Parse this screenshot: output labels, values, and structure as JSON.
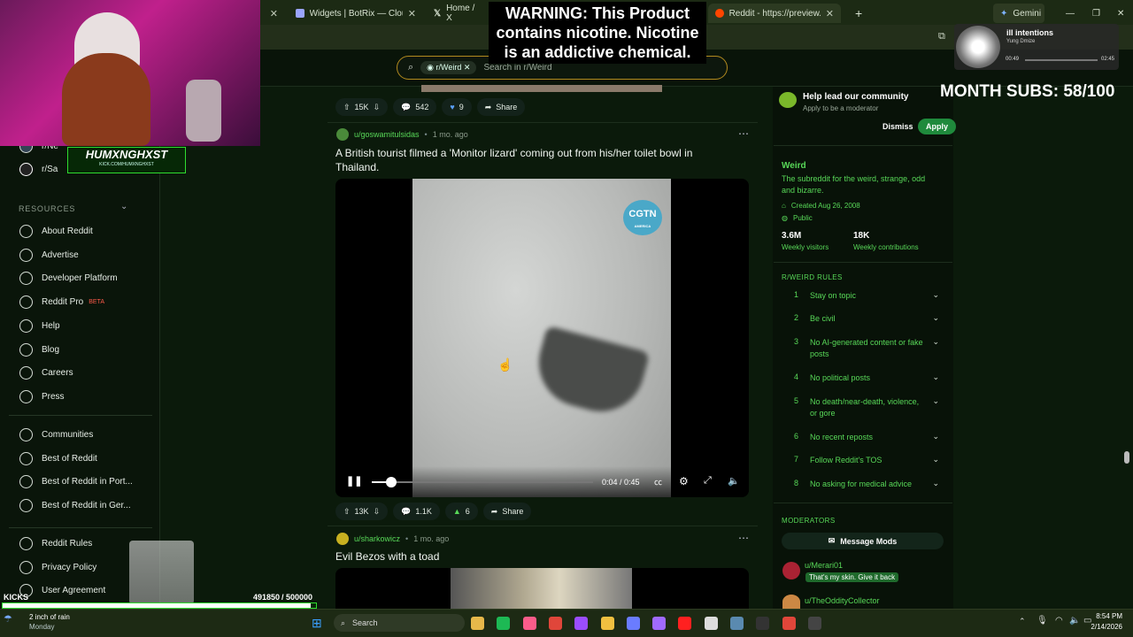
{
  "browser": {
    "tabs": [
      {
        "label": "Widgets | BotRix — Cloud Strea",
        "icon": "botrix-icon"
      },
      {
        "label": "Home / X",
        "icon": "x-logo-icon"
      },
      {
        "label": "Reddit - https://preview.redd.it",
        "icon": "reddit-icon"
      }
    ],
    "gemini_label": "Gemini"
  },
  "overlay": {
    "warning": "WARNING: This Product contains nicotine. Nicotine is an addictive chemical.",
    "subs": "MONTH SUBS: 58/100",
    "streamer_name": "HUMXNGHXST",
    "streamer_url": "KICK.COM/HUMXNGHXST",
    "kicks_label": "KICKS",
    "kicks_value": "491850",
    "kicks_goal": "/ 500000",
    "music_title": "ill intentions",
    "music_artist": "Yung Dmize",
    "music_elapsed": "00:49",
    "music_total": "02:45"
  },
  "search": {
    "chip": "r/Weird",
    "placeholder": "Search in r/Weird"
  },
  "sidebar": {
    "partial_items": [
      "r/Ne",
      "r/Sa"
    ],
    "resources_label": "RESOURCES",
    "items": [
      {
        "label": "About Reddit",
        "icon": "reddit-alien-icon"
      },
      {
        "label": "Advertise",
        "icon": "megaphone-icon"
      },
      {
        "label": "Developer Platform",
        "icon": "developer-icon"
      },
      {
        "label": "Reddit Pro",
        "icon": "pro-icon",
        "badge": "BETA"
      },
      {
        "label": "Help",
        "icon": "help-icon"
      },
      {
        "label": "Blog",
        "icon": "blog-icon"
      },
      {
        "label": "Careers",
        "icon": "careers-icon"
      },
      {
        "label": "Press",
        "icon": "press-icon"
      }
    ],
    "items2": [
      {
        "label": "Communities",
        "icon": "communities-icon"
      },
      {
        "label": "Best of Reddit",
        "icon": "book-icon"
      },
      {
        "label": "Best of Reddit in Port...",
        "icon": "translate-icon"
      },
      {
        "label": "Best of Reddit in Ger...",
        "icon": "translate-icon"
      }
    ],
    "items3": [
      {
        "label": "Reddit Rules",
        "icon": "rules-icon"
      },
      {
        "label": "Privacy Policy",
        "icon": "privacy-icon"
      },
      {
        "label": "User Agreement",
        "icon": "agreement-icon"
      }
    ]
  },
  "post0": {
    "votes": "15K",
    "comments": "542",
    "awards": "9",
    "share": "Share"
  },
  "post1": {
    "author": "u/goswamitulsidas",
    "age": "1 mo. ago",
    "title": "A British tourist filmed a 'Monitor lizard' coming out from his/her toilet bowl in Thailand.",
    "watermark": "CGTN",
    "watermark_sub": "AMERICA",
    "time": "0:04 / 0:45",
    "progress": 0.089,
    "votes": "13K",
    "comments": "1.1K",
    "awards": "6",
    "share": "Share"
  },
  "post2": {
    "author": "u/sharkowicz",
    "age": "1 mo. ago",
    "title": "Evil Bezos with a toad"
  },
  "rail": {
    "mod_title": "Help lead our community",
    "mod_sub": "Apply to be a moderator",
    "dismiss": "Dismiss",
    "apply": "Apply",
    "sub_name": "Weird",
    "sub_desc": "The subreddit for the weird, strange, odd and bizarre.",
    "created": "Created Aug 26, 2008",
    "visibility": "Public",
    "visitors": "3.6M",
    "visitors_label": "Weekly visitors",
    "contribs": "18K",
    "contribs_label": "Weekly contributions",
    "rules_title": "R/WEIRD RULES",
    "rules": [
      {
        "n": "1",
        "t": "Stay on topic"
      },
      {
        "n": "2",
        "t": "Be civil"
      },
      {
        "n": "3",
        "t": "No AI-generated content or fake posts"
      },
      {
        "n": "4",
        "t": "No political posts"
      },
      {
        "n": "5",
        "t": "No death/near-death, violence, or gore"
      },
      {
        "n": "6",
        "t": "No recent reposts"
      },
      {
        "n": "7",
        "t": "Follow Reddit's TOS"
      },
      {
        "n": "8",
        "t": "No asking for medical advice"
      }
    ],
    "moderators_title": "MODERATORS",
    "message_mods": "Message Mods",
    "mods": [
      {
        "name": "u/Merari01",
        "flair": "That's my skin. Give it back"
      },
      {
        "name": "u/TheOddityCollector",
        "flair": ""
      }
    ]
  },
  "taskbar": {
    "weather": "2 inch of rain",
    "weather_sub": "Monday",
    "search": "Search",
    "time": "8:54 PM",
    "date": "2/14/2026"
  },
  "colors": {
    "accent_green": "#58d858",
    "apply_green": "#1f8a3c",
    "search_border": "#b38a1e"
  }
}
